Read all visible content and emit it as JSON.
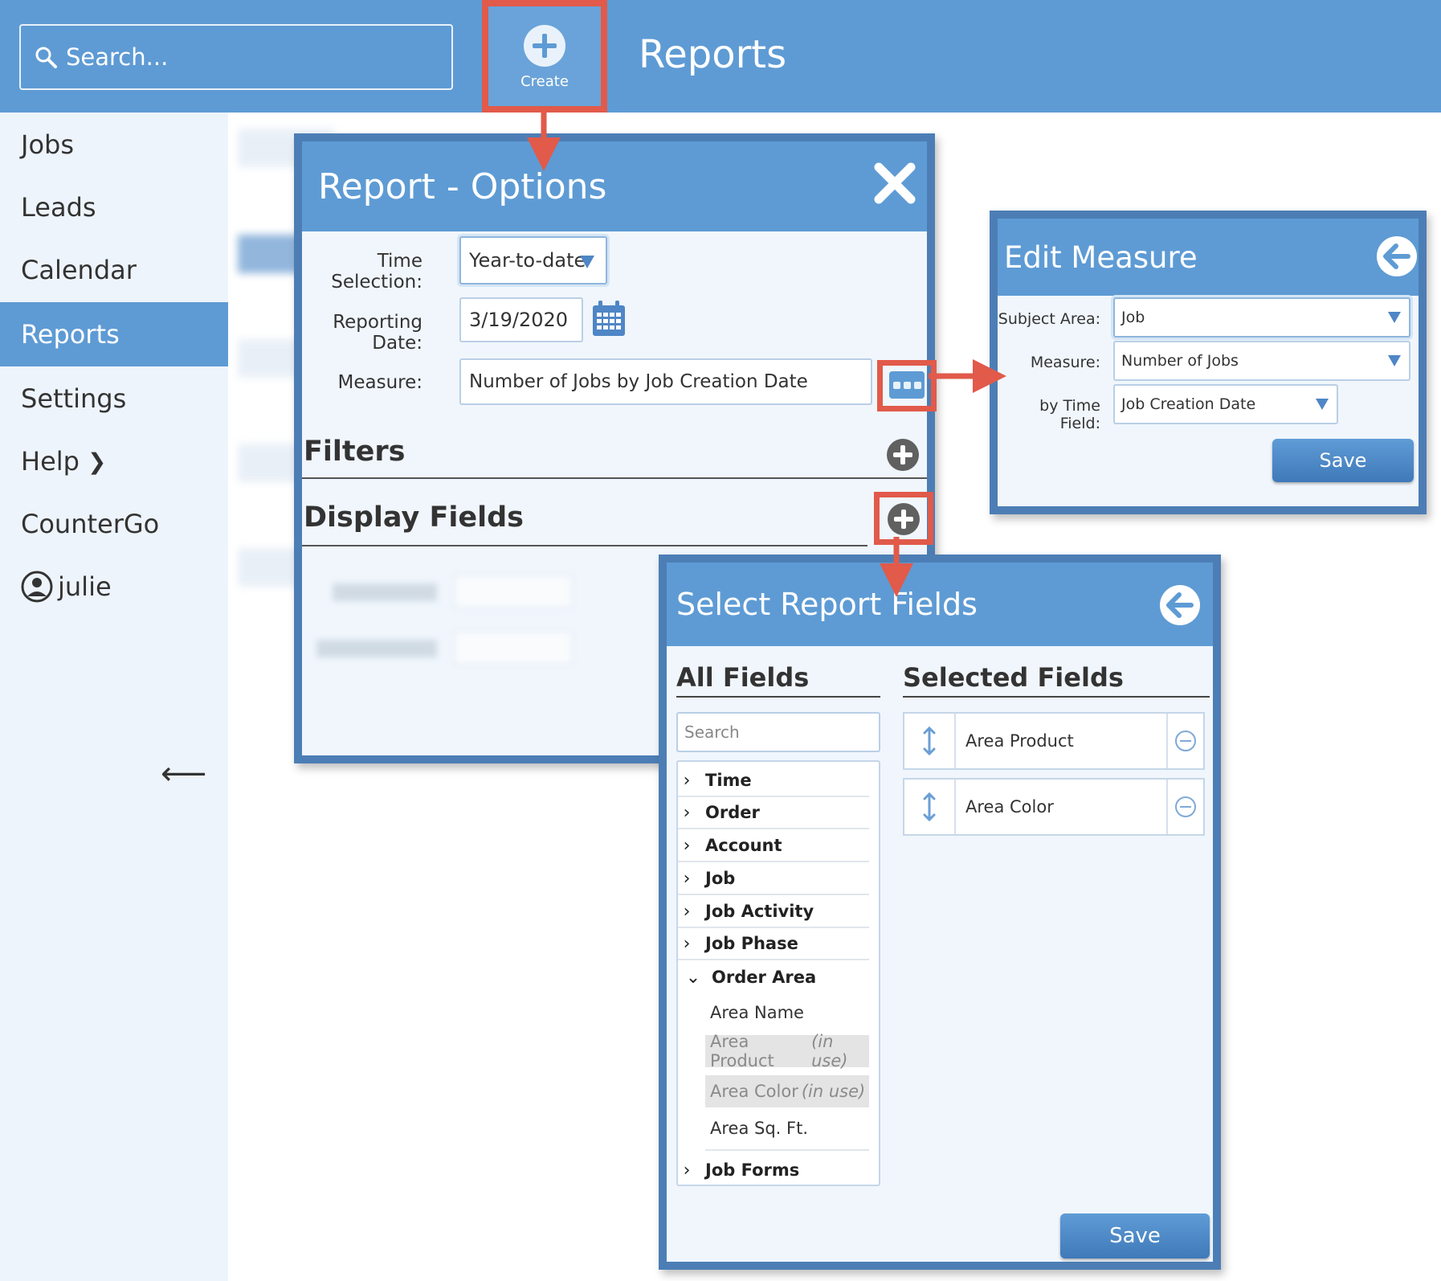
{
  "topbar": {
    "search_placeholder": "Search...",
    "create_label": "Create",
    "page_title": "Reports"
  },
  "sidebar": {
    "items": [
      {
        "label": "Jobs"
      },
      {
        "label": "Leads"
      },
      {
        "label": "Calendar"
      },
      {
        "label": "Reports",
        "active": true
      },
      {
        "label": "Settings"
      },
      {
        "label": "Help"
      },
      {
        "label": "CounterGo"
      },
      {
        "label": "julie"
      }
    ]
  },
  "report_options": {
    "title": "Report - Options",
    "time_selection_label": "Time Selection:",
    "time_selection_value": "Year-to-date",
    "reporting_date_label": "Reporting Date:",
    "reporting_date_value": "3/19/2020",
    "measure_label": "Measure:",
    "measure_value": "Number of Jobs by Job Creation Date",
    "filters_title": "Filters",
    "display_fields_title": "Display Fields"
  },
  "edit_measure": {
    "title": "Edit Measure",
    "subject_area_label": "Subject Area:",
    "subject_area_value": "Job",
    "measure_label": "Measure:",
    "measure_value": "Number of Jobs",
    "time_field_label": "by Time Field:",
    "time_field_value": "Job Creation Date",
    "save_label": "Save"
  },
  "select_fields": {
    "title": "Select Report Fields",
    "all_fields_title": "All Fields",
    "selected_fields_title": "Selected Fields",
    "search_placeholder": "Search",
    "categories": [
      "Time",
      "Order",
      "Account",
      "Job",
      "Job Activity",
      "Job Phase",
      "Order Area",
      "Job Forms"
    ],
    "order_area_fields": [
      {
        "name": "Area Name"
      },
      {
        "name": "Area Product",
        "note": "(in use)"
      },
      {
        "name": "Area Color",
        "note": "(in use)"
      },
      {
        "name": "Area Sq. Ft."
      }
    ],
    "selected": [
      "Area Product",
      "Area Color"
    ],
    "save_label": "Save"
  },
  "colors": {
    "brand_blue": "#5e9bd4",
    "panel_border": "#4c7eb5",
    "highlight_red": "#e15a4a"
  }
}
